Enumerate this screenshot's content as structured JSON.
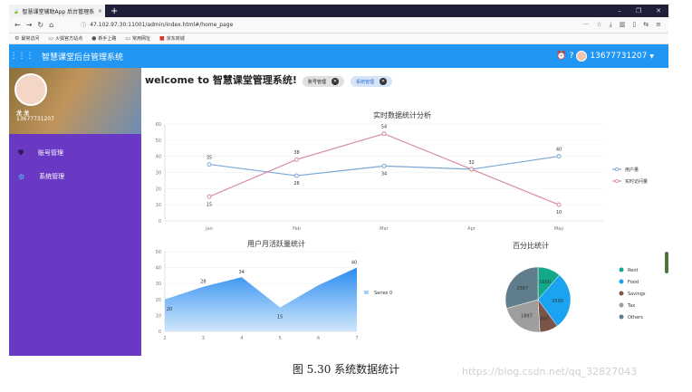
{
  "browser": {
    "tab_title": "智慧课堂辅助App 后台管理系",
    "tab_close": "×",
    "new_tab": "+",
    "url": "47.102.97.30:11001/admin/index.html#/home_page",
    "bookmarks": [
      "最常访问",
      "火狐官方站点",
      "新手上路",
      "常用网址",
      "京东商城"
    ]
  },
  "app": {
    "title": "智慧课堂后台管理系统",
    "user_phone": "13677731207"
  },
  "sidebar": {
    "profile_name": "龙 龙",
    "profile_phone": "13677731207",
    "items": [
      {
        "label": "账号管理",
        "icon": "shield-icon"
      },
      {
        "label": "系统管理",
        "icon": "gear-icon"
      }
    ]
  },
  "main": {
    "welcome": "welcome to 智慧课堂管理系统!",
    "tabs": [
      {
        "label": "账号管理"
      },
      {
        "label": "系统管理"
      }
    ]
  },
  "colors": {
    "header": "#2196f3",
    "sidebar": "#6a39c4",
    "series_user": "#7ba7d6",
    "series_visit": "#d58ca0"
  },
  "chart_data": [
    {
      "type": "line",
      "title": "实时数据统计分析",
      "categories": [
        "Jan",
        "Feb",
        "Mar",
        "Apr",
        "May"
      ],
      "ylim": [
        0,
        60
      ],
      "yticks": [
        0,
        10,
        20,
        30,
        40,
        50,
        60
      ],
      "series": [
        {
          "name": "用户量",
          "values": [
            35,
            28,
            34,
            32,
            40
          ]
        },
        {
          "name": "实时访问量",
          "values": [
            15,
            38,
            54,
            32,
            10
          ]
        }
      ],
      "legend": "right"
    },
    {
      "type": "area",
      "title": "用户月活跃量统计",
      "x": [
        2,
        3,
        4,
        5,
        6,
        7
      ],
      "xticks": [
        "2",
        "3",
        "4",
        "5",
        "6",
        "7"
      ],
      "ylim": [
        0,
        50
      ],
      "yticks": [
        0,
        10,
        20,
        30,
        40,
        50
      ],
      "series": [
        {
          "name": "Series 0",
          "values": [
            20,
            28,
            34,
            15,
            29,
            40
          ]
        }
      ],
      "point_labels": [
        {
          "x": 2,
          "label": "20"
        },
        {
          "x": 3,
          "label": "28"
        },
        {
          "x": 4,
          "label": "34"
        },
        {
          "x": 5,
          "label": "15"
        },
        {
          "x": 7,
          "label": "40"
        }
      ],
      "legend": "right"
    },
    {
      "type": "pie",
      "title": "百分比统计",
      "slices": [
        {
          "name": "Rent",
          "value": 1000,
          "color": "#12a889"
        },
        {
          "name": "Food",
          "value": 2500,
          "color": "#1aa3f0"
        },
        {
          "name": "Savings",
          "value": 800,
          "color": "#7a5548"
        },
        {
          "name": "Tax",
          "value": 1897,
          "color": "#9e9e9e"
        },
        {
          "name": "Others",
          "value": 2567,
          "color": "#607d8b"
        }
      ],
      "legend": "right"
    }
  ],
  "caption": "图 5.30 系统数据统计",
  "watermark": "https://blog.csdn.net/qq_32827043"
}
